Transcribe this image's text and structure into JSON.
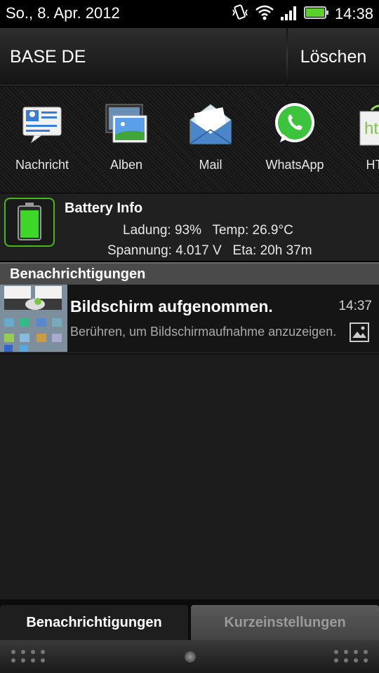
{
  "status_bar": {
    "date": "So., 8. Apr. 2012",
    "time": "14:38",
    "icons": [
      "vibrate-icon",
      "wifi-icon",
      "signal-icon",
      "battery-icon"
    ]
  },
  "carrier": {
    "name": "BASE DE",
    "clear_label": "Löschen"
  },
  "apps": [
    {
      "label": "Nachricht",
      "icon": "message-icon"
    },
    {
      "label": "Alben",
      "icon": "gallery-icon"
    },
    {
      "label": "Mail",
      "icon": "mail-icon"
    },
    {
      "label": "WhatsApp",
      "icon": "whatsapp-icon"
    },
    {
      "label": "HTC",
      "icon": "htc-icon"
    }
  ],
  "battery_info": {
    "title": "Battery Info",
    "line1": "Ladung: 93%   Temp: 26.9°C",
    "line2": "Spannung: 4.017 V   Eta: 20h 37m"
  },
  "section": {
    "title": "Benachrichtigungen"
  },
  "notification": {
    "title": "Bildschirm aufgenommen.",
    "time": "14:37",
    "body": "Berühren, um Bildschirmaufnahme anzuzeigen."
  },
  "tabs": {
    "active": "Benachrichtigungen",
    "inactive": "Kurzeinstellungen"
  },
  "colors": {
    "accent_green": "#4ab81a",
    "section_bg": "#4a4a4a"
  }
}
